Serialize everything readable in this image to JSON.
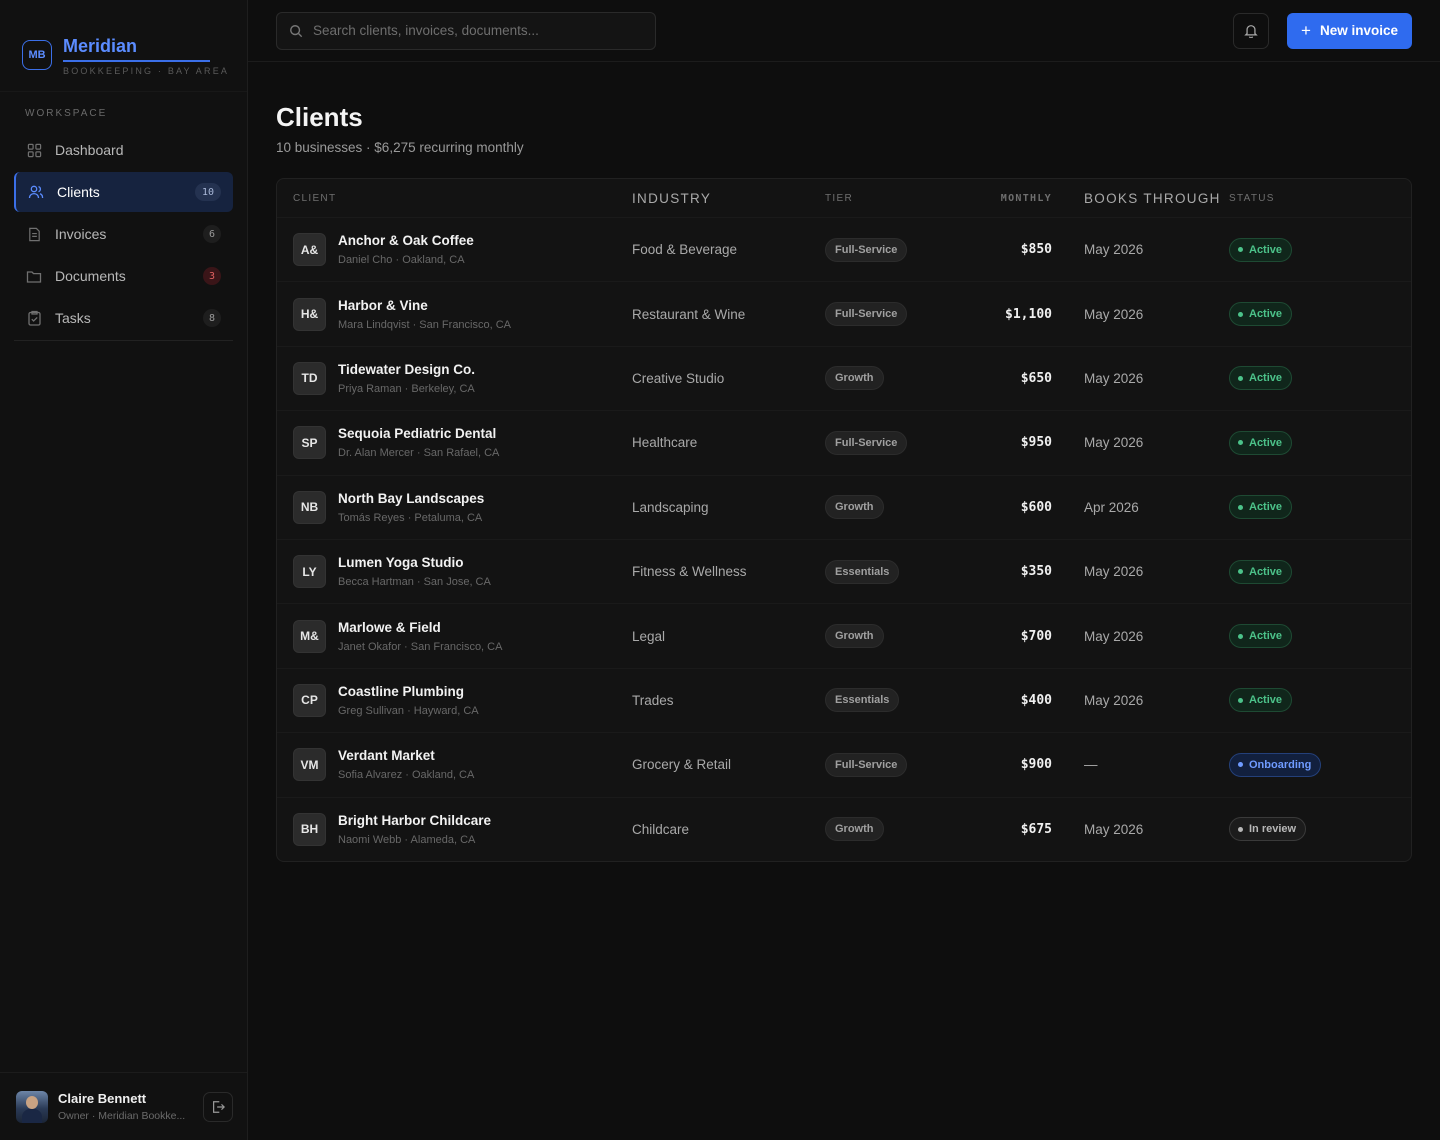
{
  "brand": {
    "initials": "MB",
    "name": "Meridian",
    "tagline": "BOOKKEEPING · BAY AREA"
  },
  "sidebar": {
    "section_label": "WORKSPACE",
    "items": [
      {
        "label": "Dashboard",
        "icon": "grid-icon",
        "count": null
      },
      {
        "label": "Clients",
        "icon": "users-icon",
        "count": "10"
      },
      {
        "label": "Invoices",
        "icon": "receipt-icon",
        "count": "6"
      },
      {
        "label": "Documents",
        "icon": "folder-icon",
        "count": "3"
      },
      {
        "label": "Tasks",
        "icon": "clipboard-icon",
        "count": "8"
      }
    ],
    "user": {
      "name": "Claire Bennett",
      "role": "Owner · Meridian Bookke..."
    }
  },
  "topbar": {
    "search_placeholder": "Search clients, invoices, documents...",
    "new_button_label": "New invoice"
  },
  "page": {
    "title": "Clients",
    "subtitle": "10 businesses · $6,275 recurring monthly"
  },
  "table": {
    "headers": {
      "client": "CLIENT",
      "industry": "INDUSTRY",
      "tier": "TIER",
      "monthly": "MONTHLY",
      "books": "BOOKS THROUGH",
      "status": "STATUS"
    },
    "rows": [
      {
        "initials": "A&",
        "name": "Anchor & Oak Coffee",
        "meta": "Daniel Cho · Oakland, CA",
        "industry": "Food & Beverage",
        "tier": "Full-Service",
        "monthly": "$850",
        "books": "May 2026",
        "status": "Active",
        "status_type": "active"
      },
      {
        "initials": "H&",
        "name": "Harbor & Vine",
        "meta": "Mara Lindqvist · San Francisco, CA",
        "industry": "Restaurant & Wine",
        "tier": "Full-Service",
        "monthly": "$1,100",
        "books": "May 2026",
        "status": "Active",
        "status_type": "active"
      },
      {
        "initials": "TD",
        "name": "Tidewater Design Co.",
        "meta": "Priya Raman · Berkeley, CA",
        "industry": "Creative Studio",
        "tier": "Growth",
        "monthly": "$650",
        "books": "May 2026",
        "status": "Active",
        "status_type": "active"
      },
      {
        "initials": "SP",
        "name": "Sequoia Pediatric Dental",
        "meta": "Dr. Alan Mercer · San Rafael, CA",
        "industry": "Healthcare",
        "tier": "Full-Service",
        "monthly": "$950",
        "books": "May 2026",
        "status": "Active",
        "status_type": "active"
      },
      {
        "initials": "NB",
        "name": "North Bay Landscapes",
        "meta": "Tomás Reyes · Petaluma, CA",
        "industry": "Landscaping",
        "tier": "Growth",
        "monthly": "$600",
        "books": "Apr 2026",
        "status": "Active",
        "status_type": "active"
      },
      {
        "initials": "LY",
        "name": "Lumen Yoga Studio",
        "meta": "Becca Hartman · San Jose, CA",
        "industry": "Fitness & Wellness",
        "tier": "Essentials",
        "monthly": "$350",
        "books": "May 2026",
        "status": "Active",
        "status_type": "active"
      },
      {
        "initials": "M&",
        "name": "Marlowe & Field",
        "meta": "Janet Okafor · San Francisco, CA",
        "industry": "Legal",
        "tier": "Growth",
        "monthly": "$700",
        "books": "May 2026",
        "status": "Active",
        "status_type": "active"
      },
      {
        "initials": "CP",
        "name": "Coastline Plumbing",
        "meta": "Greg Sullivan · Hayward, CA",
        "industry": "Trades",
        "tier": "Essentials",
        "monthly": "$400",
        "books": "May 2026",
        "status": "Active",
        "status_type": "active"
      },
      {
        "initials": "VM",
        "name": "Verdant Market",
        "meta": "Sofia Alvarez · Oakland, CA",
        "industry": "Grocery & Retail",
        "tier": "Full-Service",
        "monthly": "$900",
        "books": "—",
        "status": "Onboarding",
        "status_type": "onboarding"
      },
      {
        "initials": "BH",
        "name": "Bright Harbor Childcare",
        "meta": "Naomi Webb · Alameda, CA",
        "industry": "Childcare",
        "tier": "Growth",
        "monthly": "$675",
        "books": "May 2026",
        "status": "In review",
        "status_type": "review"
      }
    ]
  },
  "colors": {
    "accent": "#2f6bef",
    "active": "#4cc38a",
    "onboarding": "#6f9bff",
    "alert": "#e06060"
  }
}
